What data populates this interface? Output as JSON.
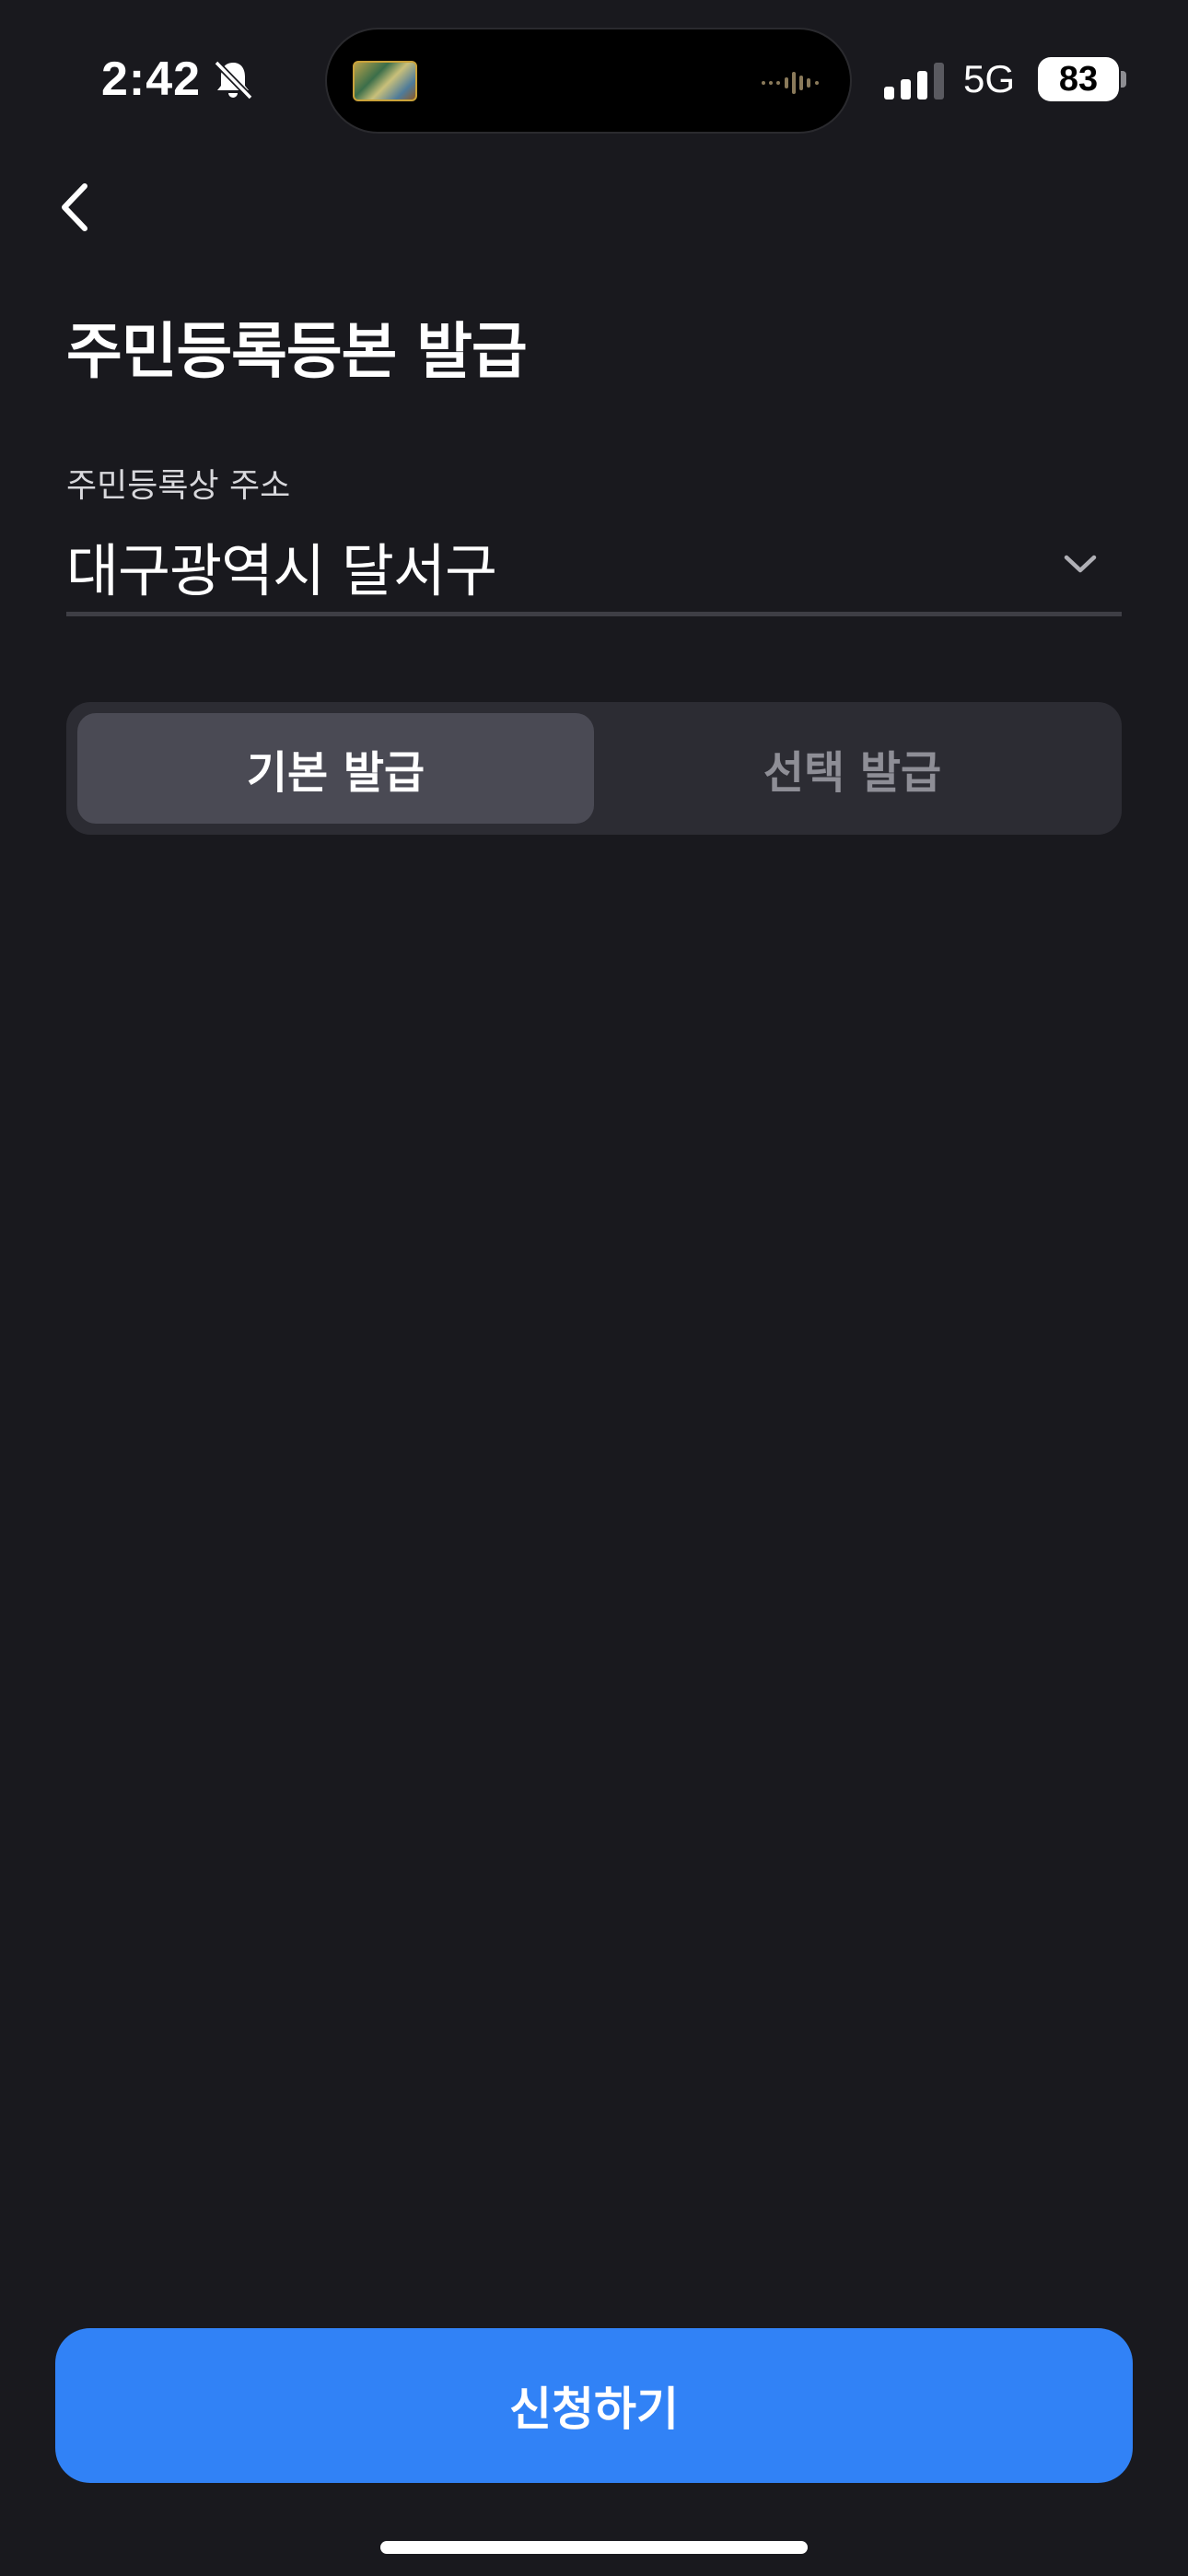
{
  "status_bar": {
    "time": "2:42",
    "network": "5G",
    "battery": "83"
  },
  "header": {
    "title": "주민등록등본 발급"
  },
  "address": {
    "label": "주민등록상 주소",
    "value": "대구광역시 달서구"
  },
  "issue_type": {
    "options": [
      "기본 발급",
      "선택 발급"
    ],
    "selected": "기본 발급"
  },
  "actions": {
    "apply_label": "신청하기"
  },
  "colors": {
    "background": "#19191e",
    "accent": "#3182f6",
    "segment_bg": "#2c2c33",
    "segment_active": "#4a4a54"
  },
  "icons": [
    "bell-slash-icon",
    "signal-icon",
    "battery-icon",
    "back-arrow-icon",
    "chevron-down-icon"
  ]
}
